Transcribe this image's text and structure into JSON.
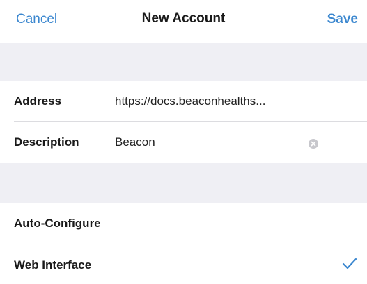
{
  "nav": {
    "cancel_label": "Cancel",
    "title": "New Account",
    "save_label": "Save"
  },
  "fields": {
    "address": {
      "label": "Address",
      "value": "https://docs.beaconhealths..."
    },
    "description": {
      "label": "Description",
      "value": "Beacon"
    }
  },
  "options": {
    "auto_configure": {
      "label": "Auto-Configure",
      "checked": false
    },
    "web_interface": {
      "label": "Web Interface",
      "checked": true
    }
  },
  "colors": {
    "accent": "#3b87cf",
    "group_background": "#efeff4",
    "separator": "#dcdce0"
  },
  "icons": {
    "clear": "clear-icon",
    "check": "checkmark-icon"
  }
}
